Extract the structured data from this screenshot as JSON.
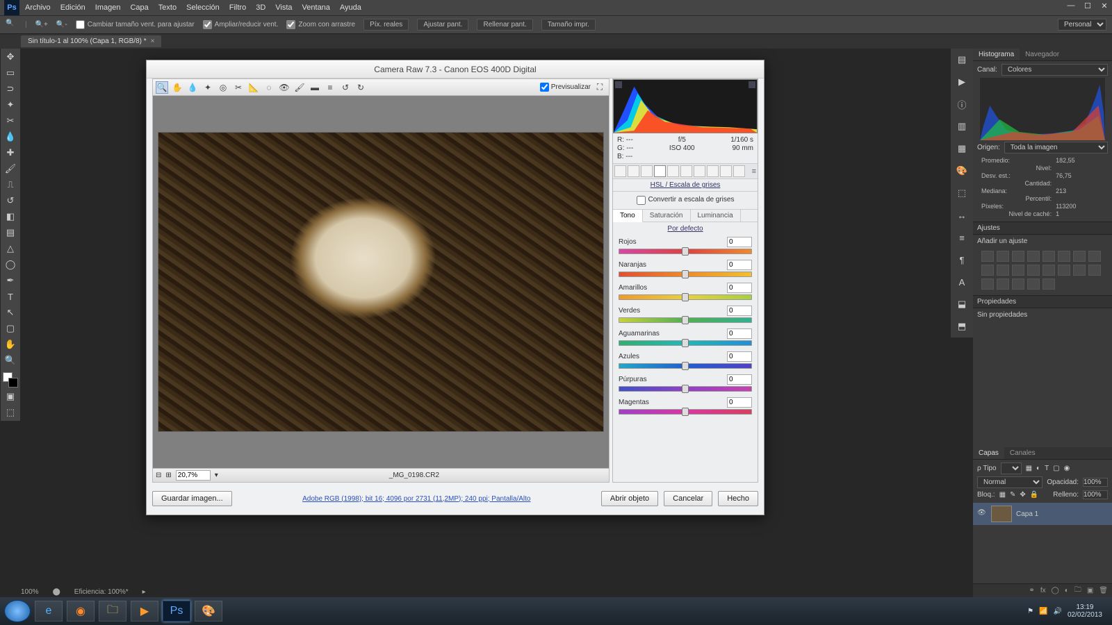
{
  "menu": {
    "items": [
      "Archivo",
      "Edición",
      "Imagen",
      "Capa",
      "Texto",
      "Selección",
      "Filtro",
      "3D",
      "Vista",
      "Ventana",
      "Ayuda"
    ]
  },
  "options": {
    "resize": "Cambiar tamaño vent. para ajustar",
    "zoom": "Ampliar/reducir vent.",
    "scrub": "Zoom con arrastre",
    "buttons": [
      "Píx. reales",
      "Ajustar pant.",
      "Rellenar pant.",
      "Tamaño impr."
    ],
    "workspace": "Personal"
  },
  "doc_tab": "Sin título-1 al 100% (Capa 1, RGB/8) *",
  "histogram": {
    "tabs": [
      "Histograma",
      "Navegador"
    ],
    "channel_label": "Canal:",
    "channel": "Colores",
    "origin_label": "Origen:",
    "origin": "Toda la imagen",
    "stats": {
      "promedio_l": "Promedio:",
      "promedio": "182,55",
      "nivel_l": "Nivel:",
      "nivel": "",
      "desv_l": "Desv. est.:",
      "desv": "76,75",
      "cant_l": "Cantidad:",
      "cant": "",
      "mediana_l": "Mediana:",
      "mediana": "213",
      "perc_l": "Percentil:",
      "perc": "",
      "pix_l": "Píxeles:",
      "pix": "113200",
      "cache_l": "Nivel de caché:",
      "cache": "1"
    }
  },
  "adjust": {
    "title": "Ajustes",
    "add": "Añadir un ajuste"
  },
  "props": {
    "title": "Propiedades",
    "none": "Sin propiedades"
  },
  "layers": {
    "tabs": [
      "Capas",
      "Canales"
    ],
    "kind_label": "ρ Tipo",
    "blend": "Normal",
    "opacity_label": "Opacidad:",
    "opacity": "100%",
    "lock_label": "Bloq.:",
    "fill_label": "Relleno:",
    "fill": "100%",
    "layer1": "Capa 1"
  },
  "cr": {
    "title": "Camera Raw 7.3  -   Canon EOS 400D Digital",
    "preview_label": "Previsualizar",
    "zoom": "20,7%",
    "filename": "_MG_0198.CR2",
    "exif": {
      "r": "R:",
      "r_v": "---",
      "fstop": "f/5",
      "shutter": "1/160 s",
      "g": "G:",
      "g_v": "---",
      "iso": "ISO 400",
      "focal": "90 mm",
      "b": "B:",
      "b_v": "---"
    },
    "panel_title": "HSL / Escala de grises",
    "gray_chk": "Convertir a escala de grises",
    "subtabs": [
      "Tono",
      "Saturación",
      "Luminancia"
    ],
    "default": "Por defecto",
    "sliders": [
      {
        "label": "Rojos",
        "val": "0",
        "grad": "linear-gradient(90deg,#d946a6,#e04040,#f08a2a)"
      },
      {
        "label": "Naranjas",
        "val": "0",
        "grad": "linear-gradient(90deg,#e05030,#f08a2a,#f0c030)"
      },
      {
        "label": "Amarillos",
        "val": "0",
        "grad": "linear-gradient(90deg,#f09a2a,#e8d040,#a8d040)"
      },
      {
        "label": "Verdes",
        "val": "0",
        "grad": "linear-gradient(90deg,#c8d040,#50b050,#30b090)"
      },
      {
        "label": "Aguamarinas",
        "val": "0",
        "grad": "linear-gradient(90deg,#30b070,#20b8b8,#2090d8)"
      },
      {
        "label": "Azules",
        "val": "0",
        "grad": "linear-gradient(90deg,#20a8c8,#2060d0,#5040c8)"
      },
      {
        "label": "Púrpuras",
        "val": "0",
        "grad": "linear-gradient(90deg,#4050c8,#9040c8,#c840b0)"
      },
      {
        "label": "Magentas",
        "val": "0",
        "grad": "linear-gradient(90deg,#a040c8,#d838a0,#d84060)"
      }
    ],
    "save_img": "Guardar imagen...",
    "link": "Adobe RGB (1998); bit 16; 4096 por 2731 (11,2MP); 240 ppi; Pantalla/Alto",
    "open": "Abrir objeto",
    "cancel": "Cancelar",
    "done": "Hecho"
  },
  "ps_status": {
    "zoom": "100%",
    "eff": "Eficiencia: 100%*"
  },
  "tray": {
    "time": "13:19",
    "date": "02/02/2013"
  }
}
